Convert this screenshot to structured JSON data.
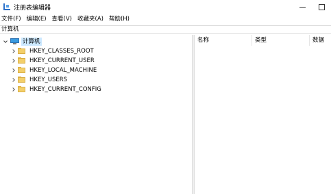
{
  "window": {
    "title": "注册表编辑器"
  },
  "menu": {
    "items": [
      {
        "label": "文件(F)"
      },
      {
        "label": "编辑(E)"
      },
      {
        "label": "查看(V)"
      },
      {
        "label": "收藏夹(A)"
      },
      {
        "label": "帮助(H)"
      }
    ]
  },
  "address": {
    "path": "计算机"
  },
  "tree": {
    "root": {
      "label": "计算机",
      "expanded": true,
      "icon": "computer-icon"
    },
    "children": [
      {
        "label": "HKEY_CLASSES_ROOT",
        "icon": "folder-icon"
      },
      {
        "label": "HKEY_CURRENT_USER",
        "icon": "folder-icon"
      },
      {
        "label": "HKEY_LOCAL_MACHINE",
        "icon": "folder-icon"
      },
      {
        "label": "HKEY_USERS",
        "icon": "folder-icon"
      },
      {
        "label": "HKEY_CURRENT_CONFIG",
        "icon": "folder-icon"
      }
    ]
  },
  "list": {
    "columns": [
      {
        "label": "名称"
      },
      {
        "label": "类型"
      },
      {
        "label": "数据"
      }
    ]
  },
  "colors": {
    "selection": "#cce8ff",
    "folder": "#f3cf6a",
    "accent": "#2b6fc8"
  }
}
